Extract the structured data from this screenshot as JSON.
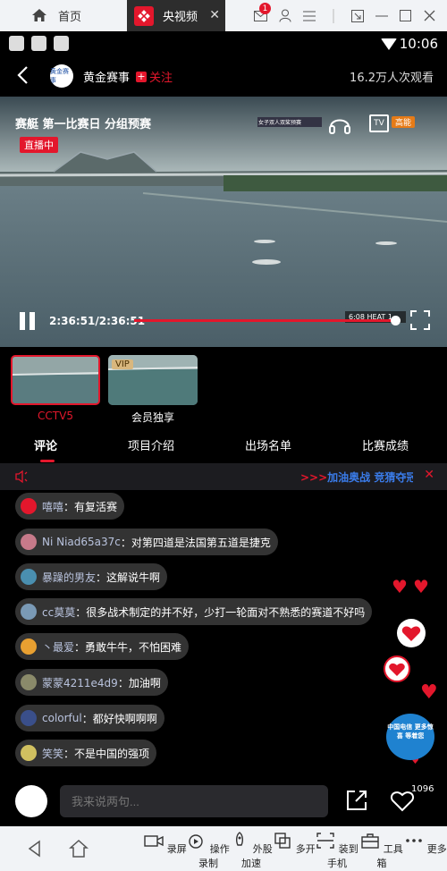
{
  "emulator": {
    "home_tab": "首页",
    "active_tab": "央视频",
    "mail_badge": "1"
  },
  "status": {
    "time": "10:06"
  },
  "channel": {
    "logo_text": "黄金赛事",
    "name": "黄金赛事",
    "follow": "关注",
    "viewers": "16.2万人次观看"
  },
  "video": {
    "title": "赛艇 第一比赛日 分组预赛",
    "live_badge": "直播中",
    "time": "2:36:51/2:36:51",
    "progress": 1.0,
    "speed_tag": "高能",
    "overlay_caption": "女子双人双桨预赛",
    "heat_label": "6:08  HEAT 1"
  },
  "thumbnails": [
    {
      "label": "CCTV5",
      "selected": true
    },
    {
      "label": "会员独享",
      "selected": false,
      "badge": "VIP"
    }
  ],
  "tabs": [
    "评论",
    "项目介绍",
    "出场名单",
    "比赛成绩"
  ],
  "announcement": {
    "arrows": ">>>",
    "text": "加油奥战 竞猜夺冠"
  },
  "comments": [
    {
      "user": "嘻嘻",
      "sep": "：",
      "text": "有复活赛",
      "avatar": "#e3172c"
    },
    {
      "user": "Ni Niad65a37c",
      "sep": "：",
      "text": "对第四道是法国第五道是捷克",
      "avatar": "#c77a8a"
    },
    {
      "user": "暴躁的男友 ",
      "sep": "：",
      "text": "这解说牛啊",
      "avatar": "#4a8fb0"
    },
    {
      "user": "cc莫莫",
      "sep": "：",
      "text": "很多战术制定的并不好，少打一轮面对不熟悉的赛道不好吗",
      "avatar": "#7a9ab6"
    },
    {
      "user": "丶最爱",
      "sep": "：",
      "text": "勇敢牛牛，不怕困难",
      "avatar": "#e8a031"
    },
    {
      "user": "蒙蒙4211e4d9",
      "sep": "：",
      "text": "加油啊",
      "avatar": "#8a8a6a"
    },
    {
      "user": "colorful",
      "sep": "：",
      "text": "都好快啊啊啊",
      "avatar": "#3a4f8a"
    },
    {
      "user": "笑笑",
      "sep": "：",
      "text": "不是中国的强项",
      "avatar": "#d0c060"
    }
  ],
  "promo": {
    "text": "中国电信 更多惊喜 等着您"
  },
  "input": {
    "placeholder": "我来说两句..."
  },
  "like_count": "1096",
  "toolbar": [
    "录屏",
    "操作录制",
    "外股加速",
    "多开",
    "装到手机",
    "工具箱",
    "更多"
  ],
  "colors": {
    "accent": "#e3172c",
    "link": "#3a7be8"
  }
}
